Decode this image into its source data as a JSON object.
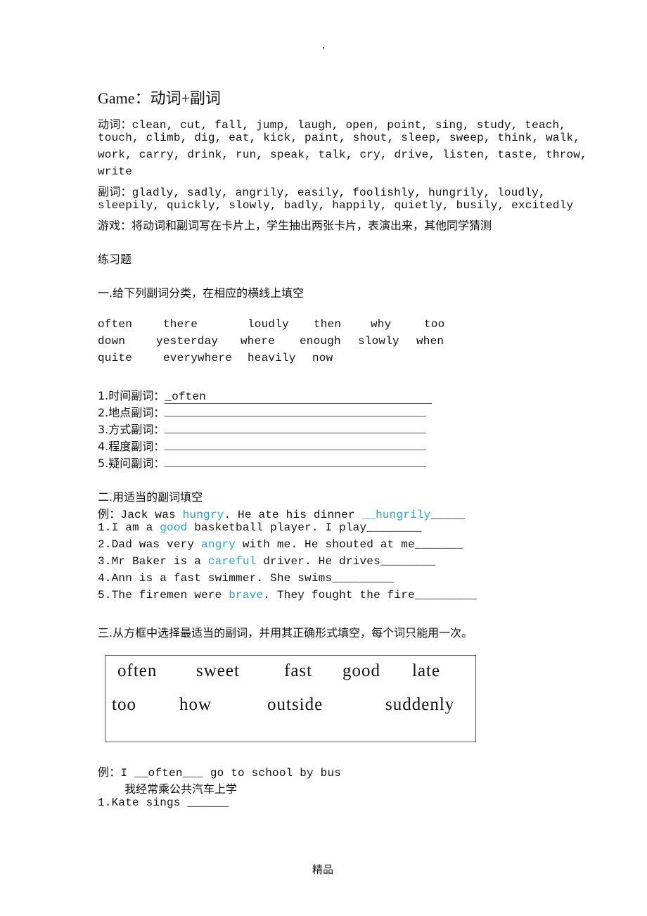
{
  "header": {
    "dot": "."
  },
  "title": "Game：动词+副词",
  "verbs": {
    "label": "动词：",
    "lines": [
      "clean, cut, fall, jump, laugh, open, point, sing, study, teach,",
      "touch, climb, dig, eat, kick, paint, shout, sleep, sweep, think, walk,",
      "work, carry, drink, run, speak, talk, cry, drive, listen, taste, throw,",
      "write"
    ]
  },
  "adverbs": {
    "label": "副词：",
    "lines": [
      "gladly, sadly, angrily, easily, foolishly, hungrily, loudly,",
      "sleepily, quickly, slowly, badly, happily, quietly, busily, excitedly"
    ]
  },
  "game_rule": "游戏：将动词和副词写在卡片上，学生抽出两张卡片，表演出来，其他同学猜测",
  "exercises_title": "练习题",
  "section1": {
    "title": "一.给下列副词分类，在相应的横线上填空",
    "word_rows": [
      [
        "often",
        "there",
        "loudly",
        "then",
        "why",
        "too"
      ],
      [
        "down",
        "yesterday",
        "where",
        "enough",
        "slowly",
        "when"
      ],
      [
        "quite",
        "everywhere",
        "heavily",
        "now"
      ]
    ],
    "categories": [
      {
        "label": "1.时间副词：",
        "answer": "_often"
      },
      {
        "label": "2.地点副词：",
        "answer": ""
      },
      {
        "label": "3.方式副词：",
        "answer": ""
      },
      {
        "label": "4.程度副词：",
        "answer": ""
      },
      {
        "label": "5.疑问副词：",
        "answer": ""
      }
    ]
  },
  "section2": {
    "title": "二.用适当的副词填空",
    "example": {
      "prefix": "例：Jack was ",
      "adj": "hungry",
      "middle": ". He ate his dinner ",
      "answer": "__hungrily",
      "suffix": "_____"
    },
    "items": [
      {
        "prefix": "1.I am a ",
        "adj": "good",
        "suffix": " basketball player. I play",
        "blank": "________"
      },
      {
        "prefix": "2.Dad was very ",
        "adj": "angry",
        "suffix": " with me. He shouted at me",
        "blank": "_______"
      },
      {
        "prefix": "3.Mr Baker is a ",
        "adj": "careful",
        "suffix": " driver. He drives",
        "blank": "________"
      },
      {
        "prefix": "4.Ann is a fast swimmer. She swims",
        "adj": "",
        "suffix": "",
        "blank": "_________"
      },
      {
        "prefix": "5.The firemen were ",
        "adj": "brave",
        "suffix": ". They fought the fire",
        "blank": "_________"
      }
    ]
  },
  "section3": {
    "title": "三.从方框中选择最适当的副词，并用其正确形式填空，每个词只能用一次。",
    "box_words": [
      "often",
      "sweet",
      "fast",
      "good",
      "late",
      "too",
      "how",
      "outside",
      "suddenly"
    ],
    "example": {
      "line1": "例：I __often___ go to school by bus",
      "line2": "我经常乘公共汽车上学"
    },
    "items": [
      {
        "text": "1.Kate sings ",
        "blank": "______"
      }
    ]
  },
  "footer": "精品",
  "colors": {
    "highlight": "#2a9fd6",
    "text": "#111111"
  }
}
